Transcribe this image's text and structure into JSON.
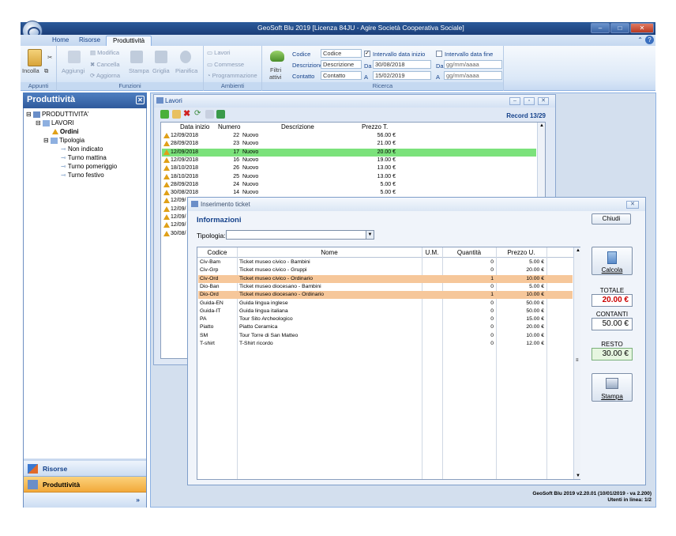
{
  "window": {
    "title": "GeoSoft Blu 2019 [Licenza 84JU - Agire Società Cooperativa Sociale]"
  },
  "ribbon_tabs": [
    {
      "label": "Home"
    },
    {
      "label": "Risorse"
    },
    {
      "label": "Produttività",
      "active": true
    }
  ],
  "ribbon": {
    "groups": {
      "appunti": "Appunti",
      "funzioni": "Funzioni",
      "ambienti": "Ambienti",
      "ricerca": "Ricerca"
    },
    "incolla": "Incolla",
    "aggiungi": "Aggiungi",
    "modifica": "Modifica",
    "cancella": "Cancella",
    "aggiorna": "Aggiorna",
    "stampa": "Stampa",
    "griglia": "Griglia",
    "pianifica": "Pianifica",
    "lavori": "Lavori",
    "commesse": "Commesse",
    "programmazione": "Programmazione",
    "filtri": "Filtri",
    "attivi": "attivi",
    "codice_label": "Codice",
    "codice_value": "Codice",
    "descrizione_label": "Descrizione",
    "descrizione_value": "Descrizione",
    "contatto_label": "Contatto",
    "contatto_value": "Contatto",
    "intervallo_inizio": "Intervallo data inizio",
    "intervallo_fine": "Intervallo data fine",
    "da": "Da",
    "a": "A",
    "inizio_da": "30/08/2018",
    "inizio_a": "15/02/2019",
    "fine_da": "gg/mm/aaaa",
    "fine_a": "gg/mm/aaaa"
  },
  "left_panel": {
    "title": "Produttività",
    "tree": [
      {
        "label": "PRODUTTIVITA'",
        "level": 0
      },
      {
        "label": "LAVORI",
        "level": 1
      },
      {
        "label": "Ordini",
        "level": 2,
        "bold": true
      },
      {
        "label": "Tipologia",
        "level": 1
      },
      {
        "label": "Non indicato",
        "level": 2
      },
      {
        "label": "Turno mattina",
        "level": 2
      },
      {
        "label": "Turno pomeriggio",
        "level": 2
      },
      {
        "label": "Turno festivo",
        "level": 2
      }
    ],
    "nav": [
      {
        "label": "Risorse"
      },
      {
        "label": "Produttività",
        "active": true
      }
    ]
  },
  "status": {
    "version": "GeoSoft Blu 2019  v2.20.01 (10/01/2019 - va 2.200)",
    "users": "Utenti in linea: 1/2"
  },
  "lavori": {
    "title": "Lavori",
    "record": "Record 13/29",
    "columns": [
      "Data inizio",
      "Numero",
      "Descrizione",
      "Prezzo T."
    ],
    "rows": [
      {
        "date": "12/09/2018",
        "num": "22",
        "desc": "Nuovo",
        "price": "56.00 €"
      },
      {
        "date": "28/09/2018",
        "num": "23",
        "desc": "Nuovo",
        "price": "21.00 €"
      },
      {
        "date": "12/09/2018",
        "num": "17",
        "desc": "Nuovo",
        "price": "20.00 €",
        "selected": true
      },
      {
        "date": "12/09/2018",
        "num": "16",
        "desc": "Nuovo",
        "price": "19.00 €"
      },
      {
        "date": "18/10/2018",
        "num": "26",
        "desc": "Nuovo",
        "price": "13.00 €"
      },
      {
        "date": "18/10/2018",
        "num": "25",
        "desc": "Nuovo",
        "price": "13.00 €"
      },
      {
        "date": "28/09/2018",
        "num": "24",
        "desc": "Nuovo",
        "price": "5.00 €"
      },
      {
        "date": "30/08/2018",
        "num": "14",
        "desc": "Nuovo",
        "price": "5.00 €"
      },
      {
        "date": "12/09/",
        "num": "",
        "desc": "",
        "price": ""
      },
      {
        "date": "12/09/",
        "num": "",
        "desc": "",
        "price": ""
      },
      {
        "date": "12/09/",
        "num": "",
        "desc": "",
        "price": ""
      },
      {
        "date": "12/09/",
        "num": "",
        "desc": "",
        "price": ""
      },
      {
        "date": "30/08/",
        "num": "",
        "desc": "",
        "price": ""
      }
    ]
  },
  "dialog": {
    "title": "Inserimento ticket",
    "section": "Informazioni",
    "chiudi": "Chiudi",
    "tipologia_label": "Tipologia:",
    "tipologia_value": "",
    "columns": [
      "Codice",
      "Nome",
      "U.M.",
      "Quantità",
      "Prezzo U."
    ],
    "rows": [
      {
        "code": "Civ-Bam",
        "name": "Ticket museo civico - Bambini",
        "um": "",
        "qty": "0",
        "price": "5.00 €"
      },
      {
        "code": "Civ-Grp",
        "name": "Ticket museo civico - Gruppi",
        "um": "",
        "qty": "0",
        "price": "20.00 €"
      },
      {
        "code": "Civ-Ord",
        "name": "Ticket museo civico - Ordinario",
        "um": "",
        "qty": "1",
        "price": "10.00 €",
        "hl": true
      },
      {
        "code": "Dio-Ban",
        "name": "Ticket museo diocesano - Bambini",
        "um": "",
        "qty": "0",
        "price": "5.00 €"
      },
      {
        "code": "Dio-Ord",
        "name": "Ticket museo diocesano - Ordinario",
        "um": "",
        "qty": "1",
        "price": "10.00 €",
        "hl": true
      },
      {
        "code": "Guida-EN",
        "name": "Guida lingua inglese",
        "um": "",
        "qty": "0",
        "price": "50.00 €"
      },
      {
        "code": "Guida-IT",
        "name": "Guida lingua italiana",
        "um": "",
        "qty": "0",
        "price": "50.00 €"
      },
      {
        "code": "PA",
        "name": "Tour Sito Archeologico",
        "um": "",
        "qty": "0",
        "price": "15.00 €"
      },
      {
        "code": "Piatto",
        "name": "Piatto Ceramica",
        "um": "",
        "qty": "0",
        "price": "20.00 €"
      },
      {
        "code": "SM",
        "name": "Tour Torre di San Matteo",
        "um": "",
        "qty": "0",
        "price": "10.00 €"
      },
      {
        "code": "T-shirt",
        "name": "T-Shirt ricordo",
        "um": "",
        "qty": "0",
        "price": "12.00 €"
      }
    ],
    "calcola": "Calcola",
    "totale_label": "TOTALE",
    "totale_value": "20.00 €",
    "contanti_label": "CONTANTI",
    "contanti_value": "50.00 €",
    "resto_label": "RESTO",
    "resto_value": "30.00 €",
    "stampa": "Stampa",
    "colors": {
      "highlight": "#f6c79a",
      "selected": "#7be27b",
      "total": "#cc0000"
    }
  }
}
